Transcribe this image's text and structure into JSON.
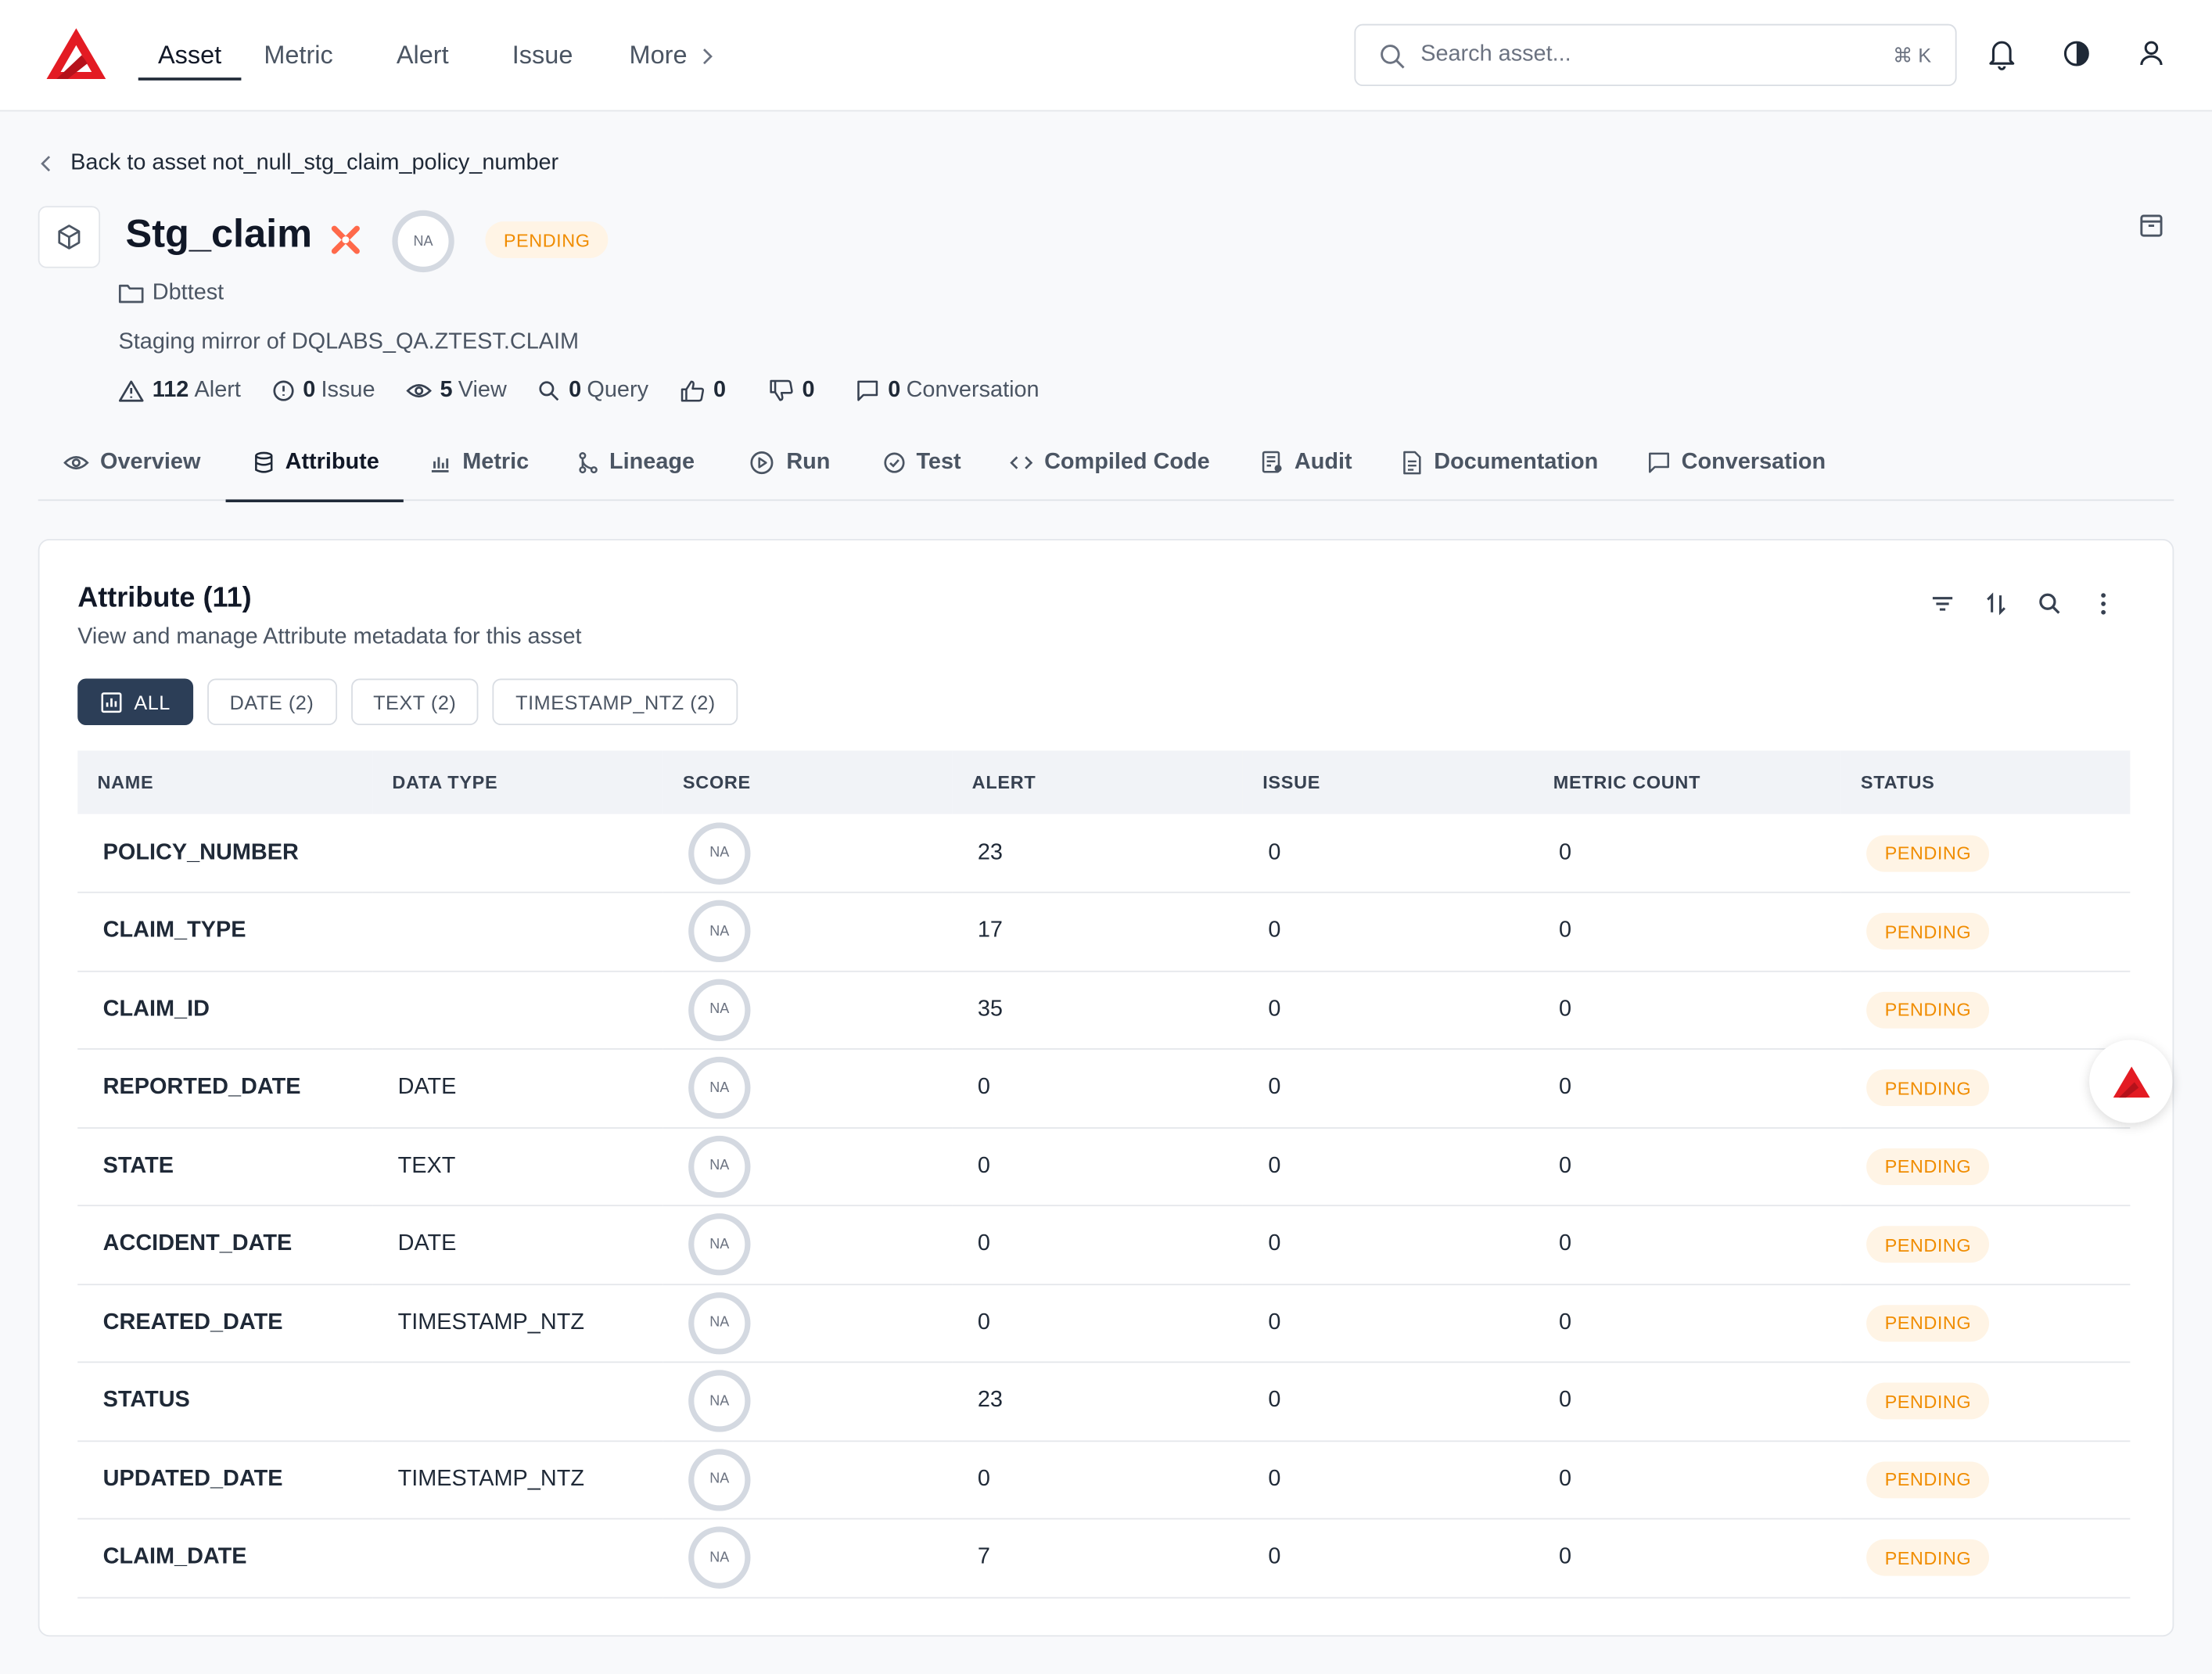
{
  "nav": {
    "items": [
      {
        "label": "Asset",
        "active": true
      },
      {
        "label": "Metric",
        "active": false
      },
      {
        "label": "Alert",
        "active": false
      },
      {
        "label": "Issue",
        "active": false
      },
      {
        "label": "More",
        "active": false
      }
    ]
  },
  "search": {
    "placeholder": "Search asset...",
    "shortcut": "⌘ K"
  },
  "header": {
    "back_label": "Back to asset not_null_stg_claim_policy_number",
    "title": "Stg_claim",
    "score": "NA",
    "status": "PENDING",
    "folder": "Dbttest",
    "description": "Staging mirror of DQLABS_QA.ZTEST.CLAIM",
    "stats": [
      {
        "value": "112",
        "label": "Alert",
        "icon": "alert-triangle-icon"
      },
      {
        "value": "0",
        "label": "Issue",
        "icon": "issue-circle-icon"
      },
      {
        "value": "5",
        "label": "View",
        "icon": "eye-icon"
      },
      {
        "value": "0",
        "label": "Query",
        "icon": "search-icon"
      },
      {
        "value": "0",
        "label": "",
        "icon": "thumbs-up-icon"
      },
      {
        "value": "0",
        "label": "",
        "icon": "thumbs-down-icon"
      },
      {
        "value": "0",
        "label": "Conversation",
        "icon": "chat-icon"
      }
    ]
  },
  "tabs": [
    {
      "label": "Overview",
      "icon": "eye-icon"
    },
    {
      "label": "Attribute",
      "icon": "database-icon",
      "active": true
    },
    {
      "label": "Metric",
      "icon": "bar-chart-icon"
    },
    {
      "label": "Lineage",
      "icon": "lineage-icon"
    },
    {
      "label": "Run",
      "icon": "play-icon"
    },
    {
      "label": "Test",
      "icon": "check-circle-icon"
    },
    {
      "label": "Compiled Code",
      "icon": "code-icon"
    },
    {
      "label": "Audit",
      "icon": "audit-icon"
    },
    {
      "label": "Documentation",
      "icon": "document-icon"
    },
    {
      "label": "Conversation",
      "icon": "chat-icon"
    }
  ],
  "card": {
    "title": "Attribute (11)",
    "subtitle": "View and manage Attribute metadata for this asset",
    "filters": [
      "ALL",
      "DATE (2)",
      "TEXT (2)",
      "TIMESTAMP_NTZ (2)"
    ],
    "columns": [
      "NAME",
      "DATA TYPE",
      "SCORE",
      "ALERT",
      "ISSUE",
      "METRIC COUNT",
      "STATUS"
    ],
    "rows": [
      {
        "name": "POLICY_NUMBER",
        "type": "",
        "score": "NA",
        "alert": "23",
        "issue": "0",
        "metric": "0",
        "status": "PENDING"
      },
      {
        "name": "CLAIM_TYPE",
        "type": "",
        "score": "NA",
        "alert": "17",
        "issue": "0",
        "metric": "0",
        "status": "PENDING"
      },
      {
        "name": "CLAIM_ID",
        "type": "",
        "score": "NA",
        "alert": "35",
        "issue": "0",
        "metric": "0",
        "status": "PENDING"
      },
      {
        "name": "REPORTED_DATE",
        "type": "DATE",
        "score": "NA",
        "alert": "0",
        "issue": "0",
        "metric": "0",
        "status": "PENDING"
      },
      {
        "name": "STATE",
        "type": "TEXT",
        "score": "NA",
        "alert": "0",
        "issue": "0",
        "metric": "0",
        "status": "PENDING"
      },
      {
        "name": "ACCIDENT_DATE",
        "type": "DATE",
        "score": "NA",
        "alert": "0",
        "issue": "0",
        "metric": "0",
        "status": "PENDING"
      },
      {
        "name": "CREATED_DATE",
        "type": "TIMESTAMP_NTZ",
        "score": "NA",
        "alert": "0",
        "issue": "0",
        "metric": "0",
        "status": "PENDING"
      },
      {
        "name": "STATUS",
        "type": "",
        "score": "NA",
        "alert": "23",
        "issue": "0",
        "metric": "0",
        "status": "PENDING"
      },
      {
        "name": "UPDATED_DATE",
        "type": "TIMESTAMP_NTZ",
        "score": "NA",
        "alert": "0",
        "issue": "0",
        "metric": "0",
        "status": "PENDING"
      },
      {
        "name": "CLAIM_DATE",
        "type": "",
        "score": "NA",
        "alert": "7",
        "issue": "0",
        "metric": "0",
        "status": "PENDING"
      }
    ]
  },
  "colors": {
    "brand": "#e31b23",
    "pending_bg": "#fff4e5",
    "pending_text": "#f08c00",
    "chip_active": "#2c3e57"
  }
}
